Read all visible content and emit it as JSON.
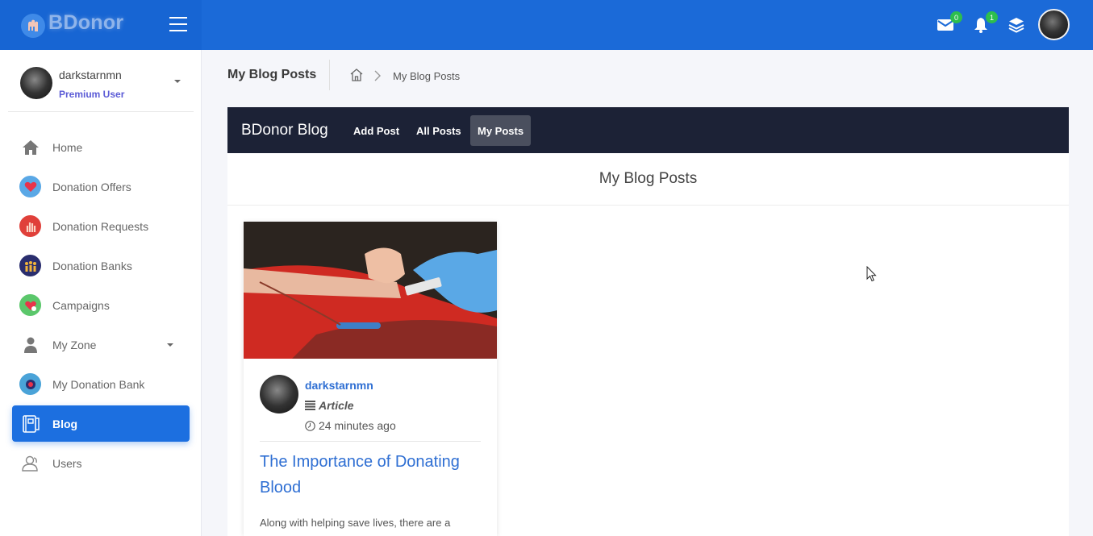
{
  "brand": {
    "name": "BDonor"
  },
  "topbar": {
    "mail_count": "0",
    "notif_count": "1"
  },
  "user": {
    "name": "darkstarnmn",
    "role": "Premium User"
  },
  "sidebar": {
    "items": [
      {
        "label": "Home",
        "icon": "home-icon"
      },
      {
        "label": "Donation Offers",
        "icon": "heart-icon"
      },
      {
        "label": "Donation Requests",
        "icon": "hand-icon"
      },
      {
        "label": "Donation Banks",
        "icon": "people-icon"
      },
      {
        "label": "Campaigns",
        "icon": "campaign-icon"
      },
      {
        "label": "My Zone",
        "icon": "user-icon"
      },
      {
        "label": "My Donation Bank",
        "icon": "bank-icon"
      },
      {
        "label": "Blog",
        "icon": "blog-icon",
        "active": true
      },
      {
        "label": "Users",
        "icon": "users-icon"
      }
    ]
  },
  "page": {
    "title": "My Blog Posts",
    "breadcrumb_current": "My Blog Posts"
  },
  "blog_nav": {
    "brand": "BDonor Blog",
    "links": [
      "Add Post",
      "All Posts",
      "My Posts"
    ],
    "active": "My Posts"
  },
  "content": {
    "heading": "My Blog Posts"
  },
  "post": {
    "author": "darkstarnmn",
    "type": "Article",
    "time": "24 minutes ago",
    "title": "The Importance of Donating Blood",
    "excerpt": "Along with helping save lives, there are a"
  },
  "colors": {
    "topbar": "#1b6ad8",
    "accent": "#1c6fe0",
    "blog_nav": "#1c2236",
    "link": "#2f6fd3",
    "badge": "#2dbe4e"
  }
}
